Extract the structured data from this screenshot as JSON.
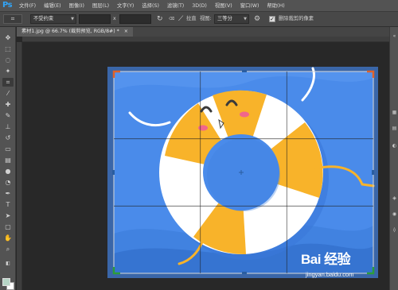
{
  "app": {
    "logo": "Ps"
  },
  "menubar": {
    "items": [
      "文件(F)",
      "编辑(E)",
      "图像(I)",
      "图层(L)",
      "文字(Y)",
      "选择(S)",
      "滤镜(T)",
      "3D(D)",
      "视图(V)",
      "窗口(W)",
      "帮助(H)"
    ]
  },
  "options": {
    "ratio_select": "不受约束",
    "x_label": "x",
    "straighten_label": "拉直",
    "view_label": "视图:",
    "view_select": "三等分",
    "delete_cropped_label": "删除裁剪的像素",
    "delete_cropped_checked": true
  },
  "document": {
    "tab_title": "素材1.jpg @ 66.7% (裁剪预览, RGB/8#) *",
    "close_glyph": "×"
  },
  "watermark": {
    "brand": "Bai 经验",
    "url": "jingyan.baidu.com"
  }
}
